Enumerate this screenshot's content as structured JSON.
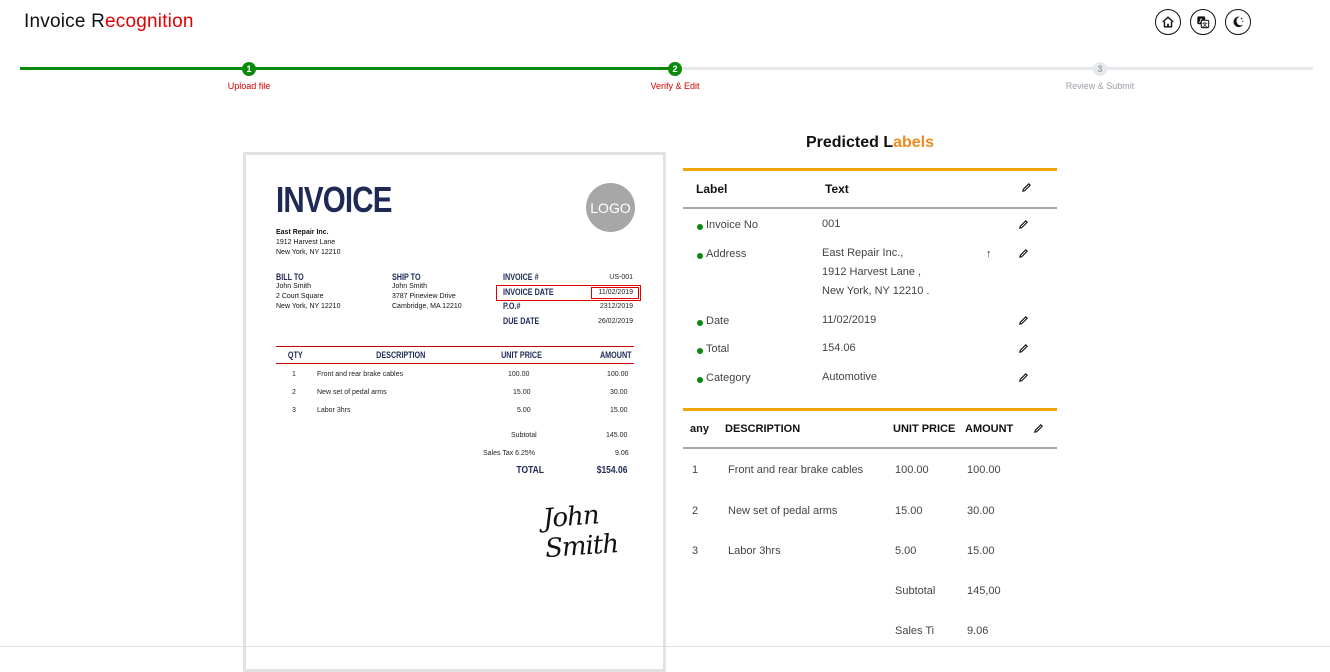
{
  "header": {
    "title_prefix": "Invoice R",
    "title_accent": "ecognition",
    "icons": [
      "home-icon",
      "translate-icon",
      "theme-toggle-icon"
    ]
  },
  "stepper": {
    "progress": 0.5,
    "steps": [
      {
        "number": "1",
        "label": "Upload file",
        "state": "done"
      },
      {
        "number": "2",
        "label": "Verify & Edit",
        "state": "current"
      },
      {
        "number": "3",
        "label": "Review & Submit",
        "state": "pending"
      }
    ]
  },
  "invoice_preview": {
    "title": "INVOICE",
    "logo": "LOGO",
    "from": {
      "company": "East Repair Inc.",
      "line1": "1912 Harvest Lane",
      "line2": "New York, NY 12210"
    },
    "bill_to": {
      "heading": "BILL TO",
      "name": "John Smith",
      "line1": "2 Court Square",
      "line2": "New York, NY 12210"
    },
    "ship_to": {
      "heading": "SHIP TO",
      "name": "John Smith",
      "line1": "3787 Pineview Drive",
      "line2": "Cambridge, MA 12210"
    },
    "meta": {
      "labels": [
        "INVOICE #",
        "INVOICE DATE",
        "P.O.#",
        "DUE DATE"
      ],
      "values": [
        "US-001",
        "11/02/2019",
        "2312/2019",
        "26/02/2019"
      ]
    },
    "table_headers": {
      "qty": "QTY",
      "description": "DESCRIPTION",
      "unit_price": "UNIT PRICE",
      "amount": "AMOUNT"
    },
    "items": [
      {
        "qty": "1",
        "description": "Front and rear brake cables",
        "unit_price": "100.00",
        "amount": "100.00"
      },
      {
        "qty": "2",
        "description": "New set of pedal arms",
        "unit_price": "15.00",
        "amount": "30.00"
      },
      {
        "qty": "3",
        "description": "Labor 3hrs",
        "unit_price": "5.00",
        "amount": "15.00"
      }
    ],
    "subtotal_label": "Subtotal",
    "subtotal_value": "145.00",
    "tax_label": "Sales Tax 6.25%",
    "tax_value": "9.06",
    "total_label": "TOTAL",
    "total_value": "$154.06",
    "signature": "John Smith"
  },
  "predicted": {
    "title_prefix": "Predicted L",
    "title_accent": "abels",
    "header_label": "Label",
    "header_text": "Text",
    "rows": [
      {
        "label": "Invoice No",
        "value": "001"
      },
      {
        "label": "Address",
        "value": "East Repair Inc.,\n1912 Harvest Lane ,\nNew York, NY 12210 ."
      },
      {
        "label": "Date",
        "value": "11/02/2019"
      },
      {
        "label": "Total",
        "value": "154.06"
      },
      {
        "label": "Category",
        "value": "Automotive"
      }
    ],
    "arrow": "↑",
    "items_headers": {
      "qty": "any",
      "description": "DESCRIPTION",
      "unit_price": "UNIT PRICE",
      "amount": "AMOUNT"
    },
    "items": [
      {
        "qty": "1",
        "description": "Front and rear brake cables",
        "unit_price": "100.00",
        "amount": "100.00"
      },
      {
        "qty": "2",
        "description": "New set of pedal arms",
        "unit_price": "15.00",
        "amount": "30.00"
      },
      {
        "qty": "3",
        "description": "Labor 3hrs",
        "unit_price": "5.00",
        "amount": "15.00"
      }
    ],
    "subtotal_label": "Subtotal",
    "subtotal_value": "145,00",
    "tax_label": "Sales Ti",
    "tax_value": "9.06"
  },
  "colors": {
    "accent_red": "#e00000",
    "success_green": "#0a8a0a",
    "orange": "#f08a1c",
    "panel_border": "#f0a500",
    "invoice_navy": "#1e2a55"
  }
}
